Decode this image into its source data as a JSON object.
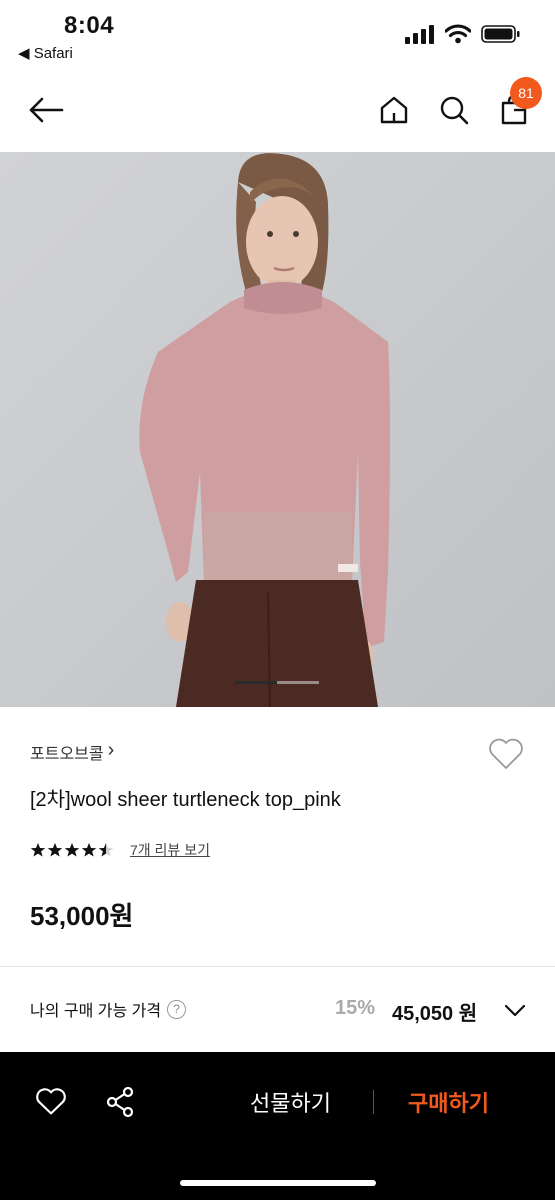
{
  "status_bar": {
    "time": "8:04",
    "back_app": "◀ Safari"
  },
  "header": {
    "cart_count": "81"
  },
  "icons": {
    "back": "back-arrow-icon",
    "home": "home-icon",
    "search": "search-icon",
    "cart": "shopping-bag-icon",
    "wishlist": "heart-icon",
    "share": "share-icon",
    "chevron": "chevron-down-icon",
    "help": "question-circle-icon"
  },
  "carousel": {
    "current": 1,
    "total": 2
  },
  "product": {
    "brand": "포트오브콜",
    "brand_chevron": "›",
    "name": "[2차]wool sheer turtleneck top_pink",
    "rating": 4.5,
    "review_link": "7개 리뷰 보기",
    "price": "53,000원"
  },
  "my_price": {
    "label": "나의 구매 가능 가격",
    "help": "?",
    "discount": "15%",
    "final_price": "45,050 원"
  },
  "bottom_bar": {
    "gift_label": "선물하기",
    "buy_label": "구매하기"
  },
  "colors": {
    "accent": "#f25a1d",
    "background": "#ffffff",
    "bottom_bar": "#000000"
  }
}
